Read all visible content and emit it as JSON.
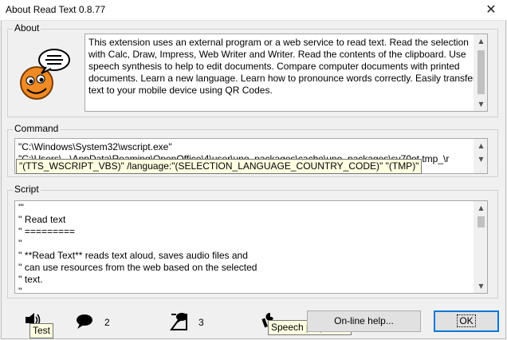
{
  "window": {
    "title": "About Read Text 0.8.77",
    "close_glyph": "✕"
  },
  "about": {
    "legend": "About",
    "lines": [
      "This extension uses an external program or a web service to read text. Read the selection",
      "with Calc, Draw, Impress, Web Writer and Writer. Read the contents of the clipboard. Use",
      "speech synthesis to help to edit documents. Compare computer documents with printed",
      "documents. Learn a new language. Learn how to pronounce words correctly. Easily transfer",
      "text to your mobile device using QR Codes."
    ]
  },
  "command": {
    "legend": "Command",
    "line1": "\"C:\\Windows\\System32\\wscript.exe\"",
    "line2": "\"C:\\Users\\...\\AppData\\Roaming\\OpenOffice\\4\\user\\uno_packages\\cache\\uno_packages\\sv70ot.tmp_\\r",
    "tooltip": "\"(TTS_WSCRIPT_VBS)\" /language:\"(SELECTION_LANGUAGE_COUNTRY_CODE)\" \"(TMP)\""
  },
  "script": {
    "legend": "Script",
    "lines": [
      "'''",
      "'' Read text",
      "'' =========",
      "''",
      "'' **Read Text** reads text aloud, saves audio files and",
      "'' can use resources from the web based on the selected",
      "'' text.",
      "''"
    ]
  },
  "toolbar": {
    "test_tooltip": "Test",
    "count_2": "2",
    "count_3": "3",
    "speech_tooltip": "Speech properties",
    "online_help_label": "On-line help...",
    "ok_label": "OK"
  },
  "colors": {
    "accent": "#0078d7",
    "tooltip_bg": "#ffffe1",
    "face": "#f08a24"
  }
}
